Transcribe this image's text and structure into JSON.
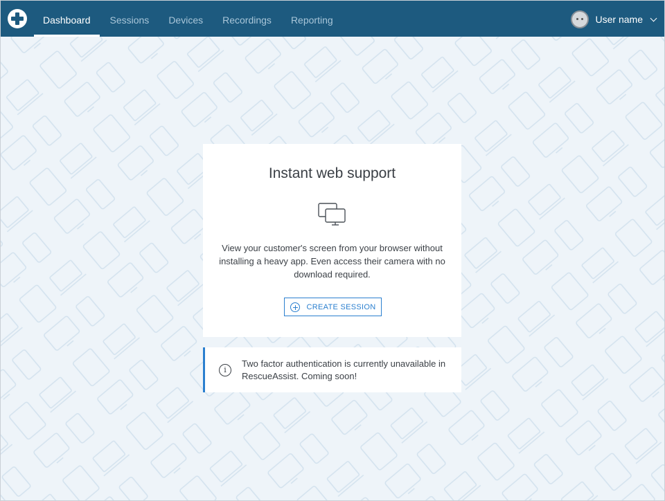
{
  "nav": {
    "items": [
      {
        "label": "Dashboard",
        "active": true
      },
      {
        "label": "Sessions",
        "active": false
      },
      {
        "label": "Devices",
        "active": false
      },
      {
        "label": "Recordings",
        "active": false
      },
      {
        "label": "Reporting",
        "active": false
      }
    ]
  },
  "user": {
    "name": "User name",
    "avatar_icon": "robot-avatar-icon",
    "menu_icon": "chevron-down-icon"
  },
  "card": {
    "title": "Instant web support",
    "icon": "screens-icon",
    "description": "View your customer's screen from your browser without installing a heavy app. Even access their camera with no download required.",
    "button_label": "CREATE SESSION",
    "button_icon": "plus-circle-icon"
  },
  "notice": {
    "icon": "info-icon",
    "text": "Two factor authentication is currently unavailable in RescueAssist. Coming soon!"
  },
  "colors": {
    "header": "#1d5a7f",
    "accent": "#2a7fcf",
    "background": "#eef4f9"
  }
}
